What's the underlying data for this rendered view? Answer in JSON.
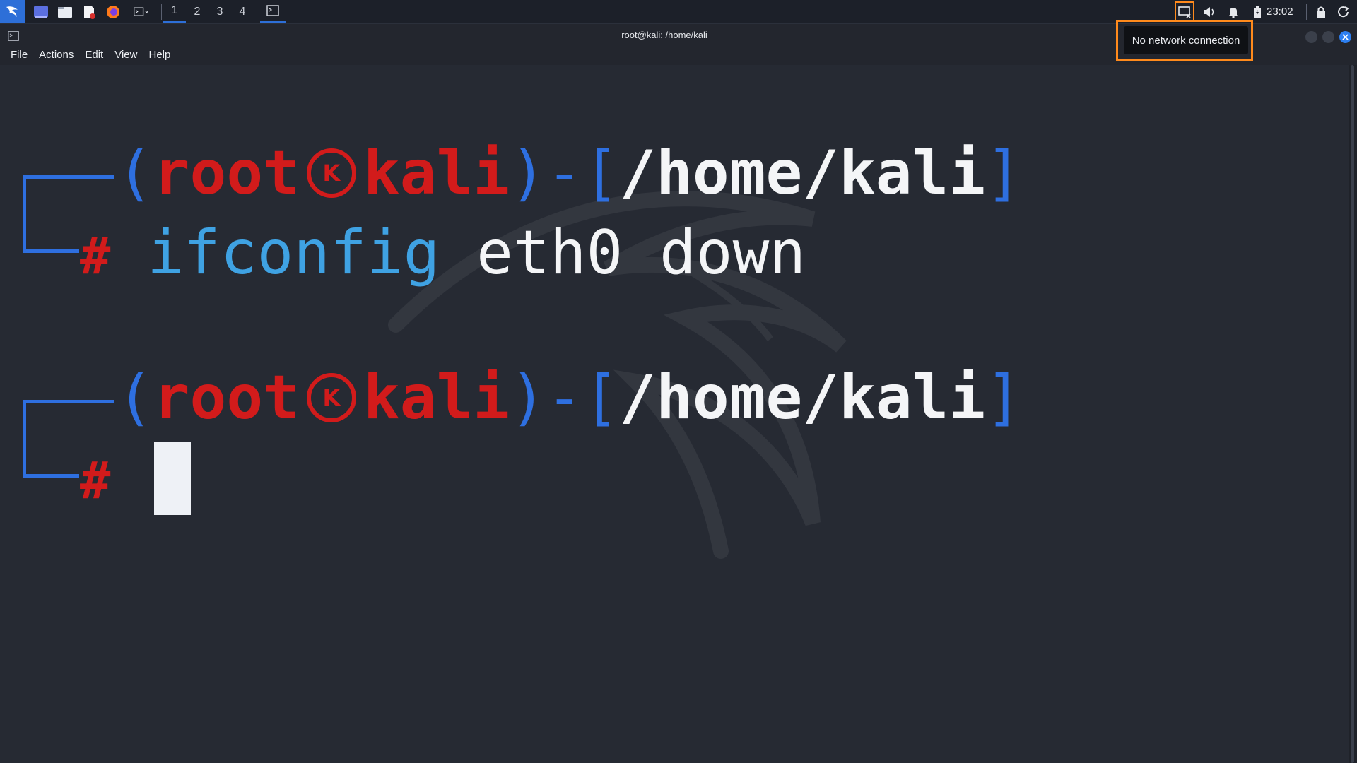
{
  "panel": {
    "workspaces": [
      "1",
      "2",
      "3",
      "4"
    ],
    "active_workspace": "1",
    "clock": "23:02",
    "launchers": [
      "desktop-icon",
      "file-manager-icon",
      "text-editor-icon",
      "firefox-icon",
      "terminal-icon"
    ],
    "tray_icons": [
      "network-icon",
      "volume-icon",
      "notification-bell-icon",
      "battery-icon",
      "lock-icon",
      "power-icon"
    ]
  },
  "window": {
    "title": "root@kali: /home/kali",
    "menu": [
      "File",
      "Actions",
      "Edit",
      "View",
      "Help"
    ]
  },
  "tooltip": {
    "text": "No network connection"
  },
  "terminal": {
    "prompt1": {
      "open_paren": "(",
      "user": "root",
      "at": "K",
      "host": "kali",
      "close_paren_dash": ")-",
      "open_bracket": "[",
      "path": "/home/kali",
      "close_bracket": "]",
      "hash": "#",
      "command": "ifconfig",
      "args": "eth0 down"
    },
    "prompt2": {
      "open_paren": "(",
      "user": "root",
      "at": "K",
      "host": "kali",
      "close_paren_dash": ")-",
      "open_bracket": "[",
      "path": "/home/kali",
      "close_bracket": "]",
      "hash": "#"
    }
  },
  "colors": {
    "accent": "#2d6fd8",
    "prompt_red": "#d21b1b",
    "prompt_blue": "#2e6fe0",
    "command_cyan": "#3fa2e3",
    "highlight_orange": "#ff8a1c"
  }
}
